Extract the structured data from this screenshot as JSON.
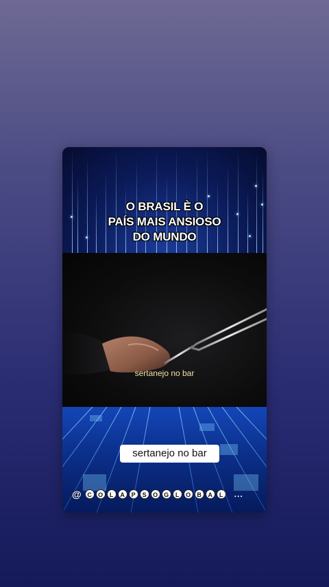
{
  "headline": {
    "line1": "O BRASIL È O",
    "line2": "PAÍS MAIS ANSIOSO",
    "line3": "DO MUNDO"
  },
  "subtitle_overlay": "sertanejo no bar",
  "caption_box": "sertanejo no bar",
  "handle": {
    "prefix": "@",
    "letters": [
      "C",
      "O",
      "L",
      "A",
      "P",
      "S",
      "O",
      "G",
      "L",
      "O",
      "B",
      "A",
      "L"
    ],
    "ellipsis": "..."
  },
  "colors": {
    "background_top": "#6e6a94",
    "background_bottom": "#141a5a",
    "headline_text": "#ffffff",
    "subtitle_text": "#f2e3a0",
    "grid_accent": "#7fd2ff"
  },
  "icons": {
    "tuning_fork": "tuning-fork-icon",
    "hand": "hand-illustration"
  }
}
